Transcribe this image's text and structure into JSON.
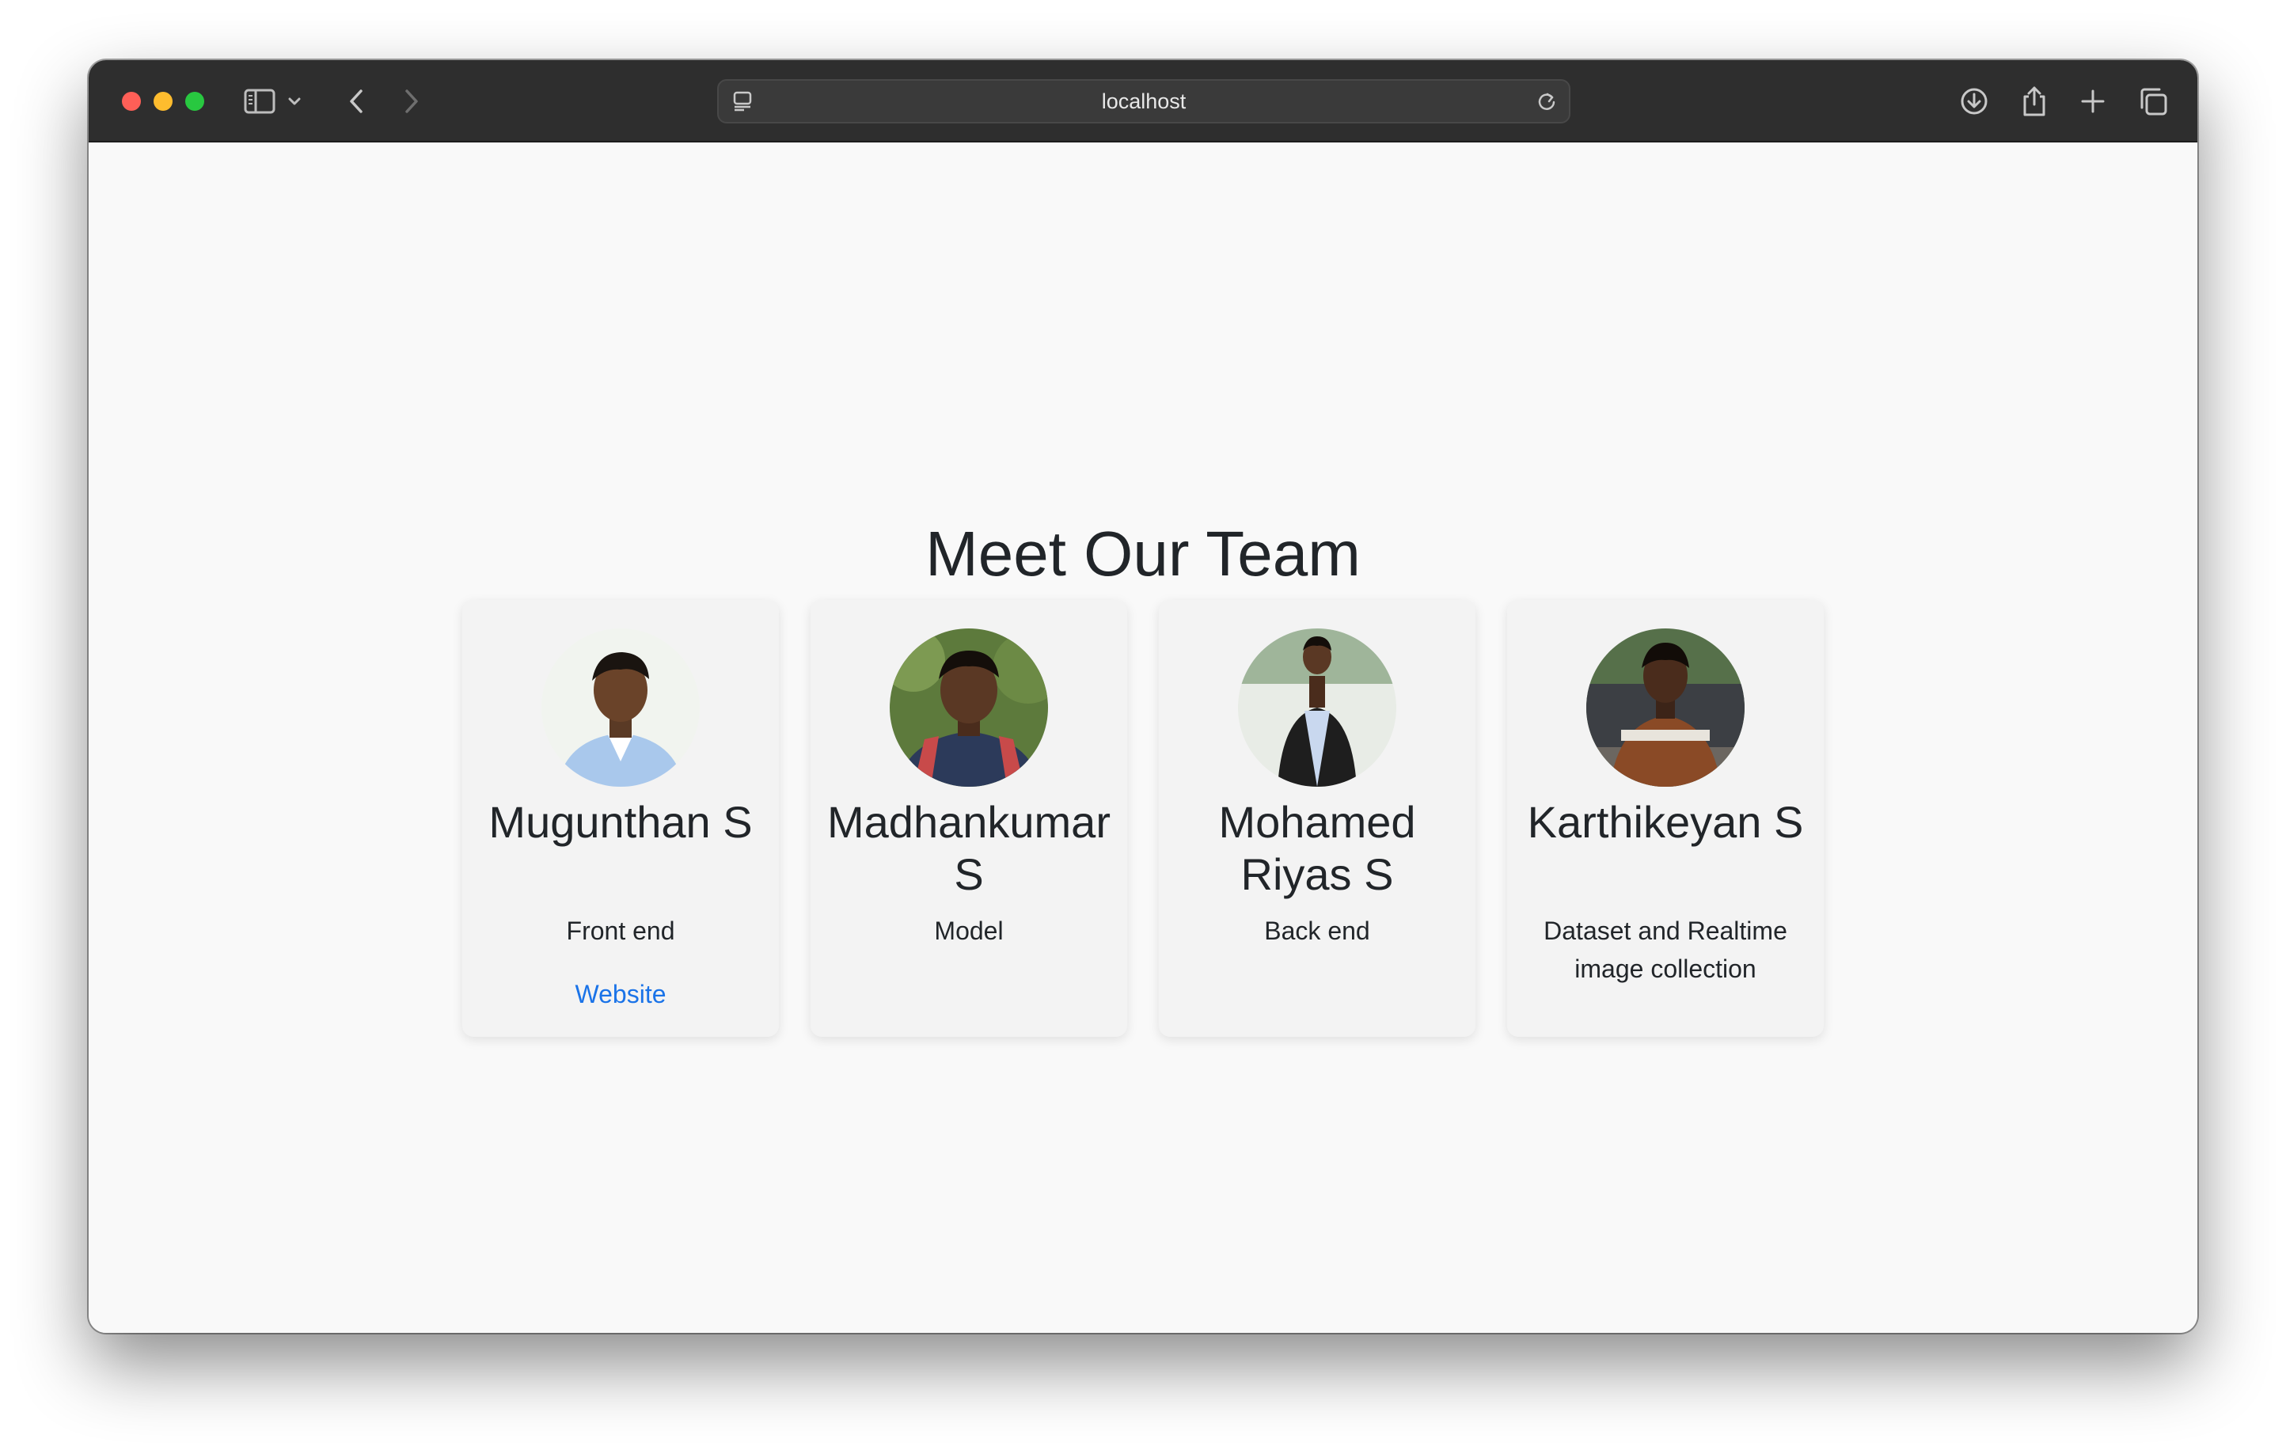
{
  "browser": {
    "url": "localhost",
    "icons": [
      "close-icon",
      "minimize-icon",
      "zoom-icon",
      "sidebar-icon",
      "chevron-down-icon",
      "back-icon",
      "forward-icon",
      "page-settings-icon",
      "reload-icon",
      "download-icon",
      "share-icon",
      "new-tab-icon",
      "tabs-overview-icon"
    ],
    "colors": {
      "close": "#ff5f57",
      "minimize": "#febc2e",
      "zoom": "#28c840",
      "toolbar": "#2e2e2e"
    }
  },
  "page": {
    "heading": "Meet Our Team",
    "members": [
      {
        "name": "Mugunthan S",
        "role": "Front end",
        "link": "Website"
      },
      {
        "name": "Madhankumar S",
        "role": "Model"
      },
      {
        "name": "Mohamed Riyas S",
        "role": "Back end"
      },
      {
        "name": "Karthikeyan S",
        "role": "Dataset and Realtime image collection"
      }
    ],
    "link_color": "#1a73e8"
  }
}
